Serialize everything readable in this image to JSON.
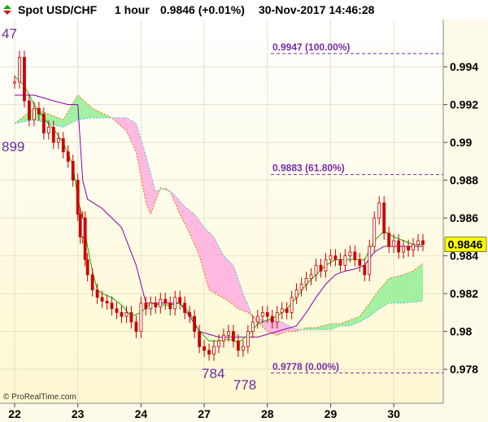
{
  "header": {
    "instrument": "Spot USD/CHF",
    "timeframe": "1 hour",
    "price": "0.9846 (+0.01%)",
    "datetime": "30-Nov-2017 14:46:28"
  },
  "copyright": "© ProRealTime.com",
  "last_price_label": "0.9846",
  "colors": {
    "candle": "#cc0000",
    "tenkan": "#00bb00",
    "kijun": "#8800aa",
    "cloud_bull": "#a0f0a0",
    "cloud_bear": "#ffb8e0",
    "senkou_a": "#ff6a00",
    "senkou_b": "#33ccdd",
    "fib": "#7a2aa8",
    "bg_top": "#ffffff",
    "bg_bottom": "#fdf8d0"
  },
  "chart_data": {
    "type": "candlestick",
    "title": "Spot USD/CHF 1 hour",
    "y_ticks": [
      "0.978",
      "0.98",
      "0.982",
      "0.984",
      "0.986",
      "0.988",
      "0.99",
      "0.992",
      "0.994"
    ],
    "x_ticks": [
      "22",
      "23",
      "24",
      "27",
      "28",
      "29",
      "30"
    ],
    "ylim": [
      0.9762,
      0.9965
    ],
    "x_day_units": [
      [
        0,
        "22"
      ],
      [
        26,
        "23"
      ],
      [
        52,
        "24"
      ],
      [
        78,
        "27"
      ],
      [
        104,
        "28"
      ],
      [
        130,
        "29"
      ],
      [
        156,
        "30"
      ]
    ],
    "x_range": [
      0,
      168
    ],
    "fib_levels": [
      {
        "label": "0.9947 (100.00%)",
        "value": 0.9947
      },
      {
        "label": "0.9883 (61.80%)",
        "value": 0.9883
      },
      {
        "label": "0.9778 (0.00%)",
        "value": 0.9778
      }
    ],
    "extreme_labels": [
      {
        "text": "47",
        "x": 0,
        "y": 0.9947
      },
      {
        "text": "899",
        "x": 0,
        "y": 0.9899
      },
      {
        "text": "784",
        "x": 81,
        "y": 0.9784
      },
      {
        "text": "778",
        "x": 94,
        "y": 0.9778
      }
    ],
    "close_series": [
      [
        0,
        0.9932
      ],
      [
        2,
        0.9945
      ],
      [
        4,
        0.9922
      ],
      [
        6,
        0.9912
      ],
      [
        8,
        0.9918
      ],
      [
        10,
        0.9915
      ],
      [
        12,
        0.9905
      ],
      [
        14,
        0.9908
      ],
      [
        16,
        0.99
      ],
      [
        18,
        0.9902
      ],
      [
        20,
        0.9895
      ],
      [
        22,
        0.989
      ],
      [
        24,
        0.988
      ],
      [
        26,
        0.9862
      ],
      [
        27,
        0.985
      ],
      [
        28,
        0.986
      ],
      [
        29,
        0.9838
      ],
      [
        30,
        0.983
      ],
      [
        32,
        0.9822
      ],
      [
        34,
        0.9818
      ],
      [
        36,
        0.9816
      ],
      [
        38,
        0.9815
      ],
      [
        40,
        0.9812
      ],
      [
        42,
        0.981
      ],
      [
        44,
        0.9808
      ],
      [
        46,
        0.981
      ],
      [
        48,
        0.9805
      ],
      [
        50,
        0.98
      ],
      [
        52,
        0.9815
      ],
      [
        54,
        0.9812
      ],
      [
        56,
        0.9815
      ],
      [
        58,
        0.9813
      ],
      [
        60,
        0.9817
      ],
      [
        62,
        0.9815
      ],
      [
        64,
        0.9812
      ],
      [
        66,
        0.9818
      ],
      [
        68,
        0.9815
      ],
      [
        70,
        0.981
      ],
      [
        72,
        0.9808
      ],
      [
        74,
        0.98
      ],
      [
        76,
        0.9792
      ],
      [
        78,
        0.979
      ],
      [
        80,
        0.9788
      ],
      [
        82,
        0.9792
      ],
      [
        84,
        0.9795
      ],
      [
        86,
        0.9798
      ],
      [
        88,
        0.98
      ],
      [
        90,
        0.9795
      ],
      [
        92,
        0.979
      ],
      [
        94,
        0.9792
      ],
      [
        96,
        0.98
      ],
      [
        98,
        0.9805
      ],
      [
        100,
        0.9808
      ],
      [
        102,
        0.981
      ],
      [
        104,
        0.9808
      ],
      [
        106,
        0.9805
      ],
      [
        108,
        0.981
      ],
      [
        110,
        0.9812
      ],
      [
        112,
        0.981
      ],
      [
        114,
        0.9818
      ],
      [
        116,
        0.9822
      ],
      [
        118,
        0.9825
      ],
      [
        120,
        0.9828
      ],
      [
        122,
        0.983
      ],
      [
        124,
        0.9835
      ],
      [
        126,
        0.9832
      ],
      [
        128,
        0.9838
      ],
      [
        130,
        0.984
      ],
      [
        132,
        0.9838
      ],
      [
        134,
        0.9835
      ],
      [
        136,
        0.984
      ],
      [
        138,
        0.9842
      ],
      [
        140,
        0.9838
      ],
      [
        142,
        0.9835
      ],
      [
        144,
        0.983
      ],
      [
        146,
        0.9845
      ],
      [
        148,
        0.986
      ],
      [
        150,
        0.9868
      ],
      [
        152,
        0.9852
      ],
      [
        154,
        0.9845
      ],
      [
        156,
        0.9848
      ],
      [
        158,
        0.9842
      ],
      [
        160,
        0.9845
      ],
      [
        162,
        0.9843
      ],
      [
        164,
        0.9846
      ],
      [
        166,
        0.9848
      ],
      [
        168,
        0.9846
      ]
    ],
    "tenkan": [
      [
        0,
        0.9935
      ],
      [
        4,
        0.993
      ],
      [
        8,
        0.992
      ],
      [
        12,
        0.9913
      ],
      [
        16,
        0.9907
      ],
      [
        20,
        0.99
      ],
      [
        24,
        0.9888
      ],
      [
        26,
        0.987
      ],
      [
        28,
        0.986
      ],
      [
        30,
        0.9845
      ],
      [
        32,
        0.9832
      ],
      [
        34,
        0.9822
      ],
      [
        36,
        0.982
      ],
      [
        40,
        0.9818
      ],
      [
        44,
        0.9814
      ],
      [
        48,
        0.9808
      ],
      [
        52,
        0.981
      ],
      [
        56,
        0.9815
      ],
      [
        60,
        0.9814
      ],
      [
        64,
        0.9814
      ],
      [
        68,
        0.9815
      ],
      [
        72,
        0.981
      ],
      [
        76,
        0.98
      ],
      [
        80,
        0.9795
      ],
      [
        84,
        0.9795
      ],
      [
        88,
        0.9796
      ],
      [
        92,
        0.9794
      ],
      [
        96,
        0.9798
      ],
      [
        100,
        0.9804
      ],
      [
        104,
        0.9806
      ],
      [
        108,
        0.9808
      ],
      [
        112,
        0.9812
      ],
      [
        116,
        0.9818
      ],
      [
        120,
        0.9825
      ],
      [
        124,
        0.983
      ],
      [
        128,
        0.9835
      ],
      [
        132,
        0.9838
      ],
      [
        136,
        0.9838
      ],
      [
        140,
        0.9838
      ],
      [
        144,
        0.9838
      ],
      [
        148,
        0.9848
      ],
      [
        152,
        0.9853
      ],
      [
        156,
        0.985
      ],
      [
        160,
        0.9848
      ],
      [
        164,
        0.9846
      ],
      [
        168,
        0.9846
      ]
    ],
    "kijun": [
      [
        0,
        0.9925
      ],
      [
        8,
        0.9925
      ],
      [
        16,
        0.9922
      ],
      [
        22,
        0.992
      ],
      [
        26,
        0.992
      ],
      [
        28,
        0.988
      ],
      [
        30,
        0.987
      ],
      [
        36,
        0.9865
      ],
      [
        44,
        0.9855
      ],
      [
        50,
        0.9835
      ],
      [
        54,
        0.9815
      ],
      [
        60,
        0.9815
      ],
      [
        68,
        0.9815
      ],
      [
        72,
        0.9808
      ],
      [
        76,
        0.98
      ],
      [
        84,
        0.9797
      ],
      [
        92,
        0.9797
      ],
      [
        100,
        0.9797
      ],
      [
        108,
        0.98
      ],
      [
        116,
        0.9803
      ],
      [
        120,
        0.981
      ],
      [
        124,
        0.9818
      ],
      [
        128,
        0.9825
      ],
      [
        132,
        0.983
      ],
      [
        136,
        0.9832
      ],
      [
        140,
        0.9833
      ],
      [
        144,
        0.9835
      ],
      [
        148,
        0.9842
      ],
      [
        152,
        0.9845
      ],
      [
        156,
        0.9845
      ],
      [
        160,
        0.9845
      ],
      [
        168,
        0.9845
      ]
    ],
    "senkou_a": [
      [
        0,
        0.991
      ],
      [
        8,
        0.9918
      ],
      [
        14,
        0.9915
      ],
      [
        20,
        0.9912
      ],
      [
        26,
        0.9925
      ],
      [
        32,
        0.9918
      ],
      [
        40,
        0.9913
      ],
      [
        46,
        0.9906
      ],
      [
        50,
        0.9895
      ],
      [
        54,
        0.9868
      ],
      [
        56,
        0.9862
      ],
      [
        60,
        0.9876
      ],
      [
        64,
        0.9874
      ],
      [
        68,
        0.9862
      ],
      [
        72,
        0.9852
      ],
      [
        76,
        0.984
      ],
      [
        80,
        0.9822
      ],
      [
        84,
        0.9819
      ],
      [
        88,
        0.9816
      ],
      [
        92,
        0.9812
      ],
      [
        96,
        0.981
      ],
      [
        100,
        0.9805
      ],
      [
        104,
        0.98
      ],
      [
        108,
        0.9798
      ],
      [
        112,
        0.98
      ],
      [
        116,
        0.98
      ],
      [
        120,
        0.9802
      ],
      [
        124,
        0.9802
      ],
      [
        130,
        0.9804
      ],
      [
        134,
        0.9804
      ],
      [
        138,
        0.9806
      ],
      [
        142,
        0.9808
      ],
      [
        146,
        0.9815
      ],
      [
        150,
        0.9822
      ],
      [
        154,
        0.9828
      ],
      [
        160,
        0.983
      ],
      [
        164,
        0.9832
      ],
      [
        168,
        0.9836
      ]
    ],
    "senkou_b": [
      [
        0,
        0.991
      ],
      [
        8,
        0.9912
      ],
      [
        14,
        0.991
      ],
      [
        20,
        0.9908
      ],
      [
        26,
        0.9912
      ],
      [
        32,
        0.9913
      ],
      [
        40,
        0.9913
      ],
      [
        46,
        0.9913
      ],
      [
        50,
        0.991
      ],
      [
        54,
        0.9893
      ],
      [
        58,
        0.9874
      ],
      [
        62,
        0.9876
      ],
      [
        66,
        0.9872
      ],
      [
        70,
        0.9866
      ],
      [
        74,
        0.9862
      ],
      [
        78,
        0.9855
      ],
      [
        82,
        0.985
      ],
      [
        86,
        0.984
      ],
      [
        90,
        0.9835
      ],
      [
        94,
        0.982
      ],
      [
        98,
        0.9808
      ],
      [
        102,
        0.9806
      ],
      [
        106,
        0.9806
      ],
      [
        110,
        0.9805
      ],
      [
        114,
        0.9802
      ],
      [
        118,
        0.9801
      ],
      [
        122,
        0.9801
      ],
      [
        126,
        0.9801
      ],
      [
        130,
        0.9801
      ],
      [
        134,
        0.9803
      ],
      [
        138,
        0.9803
      ],
      [
        142,
        0.9805
      ],
      [
        146,
        0.9808
      ],
      [
        150,
        0.9812
      ],
      [
        154,
        0.9815
      ],
      [
        160,
        0.9815
      ],
      [
        168,
        0.9816
      ]
    ]
  }
}
